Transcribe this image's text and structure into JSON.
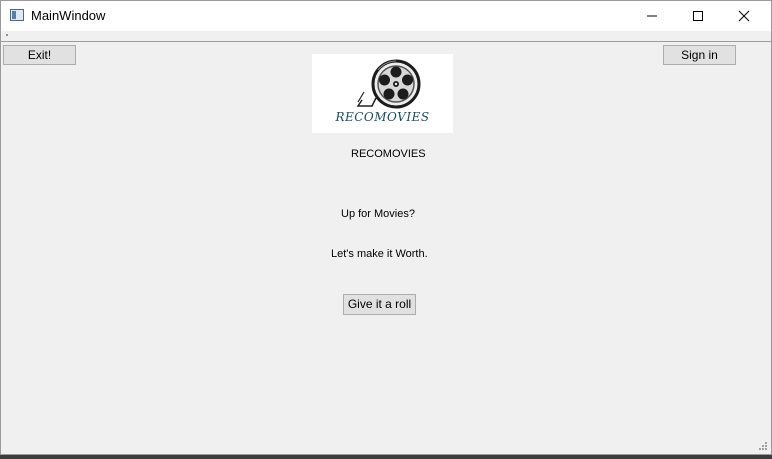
{
  "window": {
    "title": "MainWindow",
    "controls": [
      "minimize-icon",
      "maximize-icon",
      "close-icon"
    ]
  },
  "toolbar": {
    "exit_label": "Exit!",
    "signin_label": "Sign in"
  },
  "logo": {
    "icon": "film-reel-icon",
    "text": "RECOMOVIES"
  },
  "main": {
    "brand_label": "RECOMOVIES",
    "tagline": "Up for Movies?",
    "subtagline": "Let's make it Worth.",
    "roll_label": "Give it a roll"
  },
  "colors": {
    "window_bg": "#f0f0f0",
    "titlebar_bg": "#ffffff",
    "button_bg": "#e1e1e1",
    "button_border": "#adadad",
    "logo_text": "#1a4a6a"
  }
}
